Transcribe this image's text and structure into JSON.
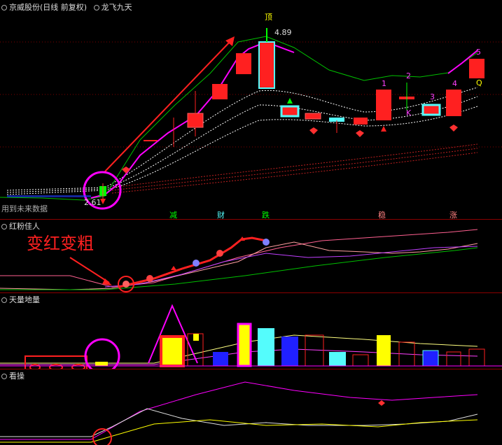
{
  "header": {
    "stock_title": "京威股份(日线 前复权)",
    "indicator_title": "龙飞九天"
  },
  "main_panel": {
    "peak_label": "顶",
    "peak_price": "4.89",
    "low_price": "2.61",
    "hint_text": "用到未来数据",
    "bottom_markers": [
      "减",
      "财",
      "跌",
      "稳",
      "涨"
    ],
    "count_labels": [
      "1",
      "2",
      "3",
      "4",
      "5"
    ],
    "letters": [
      "K",
      "Q"
    ]
  },
  "annotation": {
    "text": "变红变粗"
  },
  "panel_hongfen": {
    "title": "红粉佳人"
  },
  "panel_volume": {
    "title": "天量地量"
  },
  "panel_kancao": {
    "title": "看操"
  },
  "colors": {
    "up_red": "#ff0000",
    "down_cyan": "#54fcfc",
    "magenta": "#ff00ff",
    "green": "#00c000",
    "yellow": "#ffff00",
    "separator": "#8b0000"
  }
}
